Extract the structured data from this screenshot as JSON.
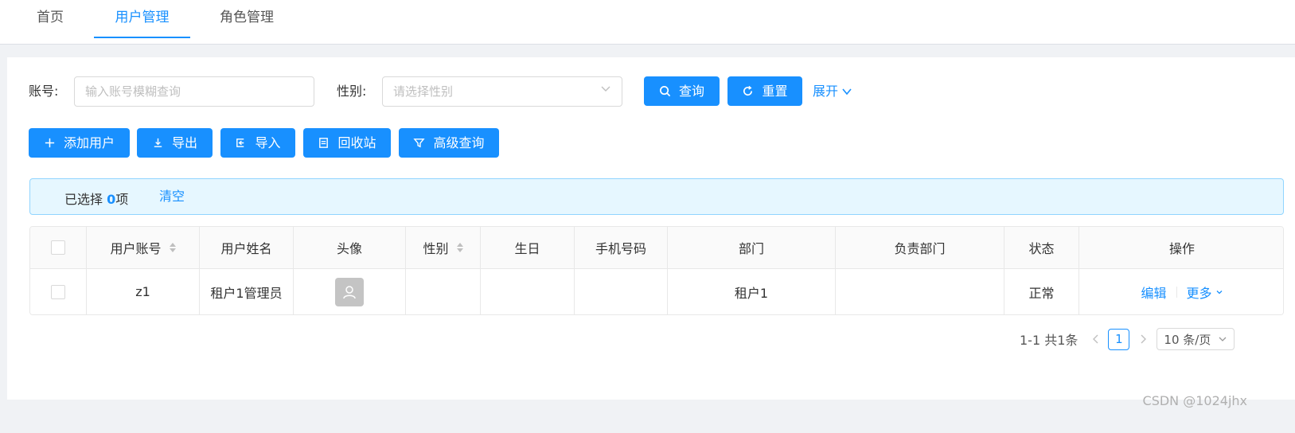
{
  "tabs": [
    {
      "label": "首页",
      "active": false
    },
    {
      "label": "用户管理",
      "active": true
    },
    {
      "label": "角色管理",
      "active": false
    }
  ],
  "search": {
    "account_label": "账号:",
    "account_placeholder": "输入账号模糊查询",
    "gender_label": "性别:",
    "gender_placeholder": "请选择性别",
    "query_button": "查询",
    "reset_button": "重置",
    "expand_link": "展开"
  },
  "toolbar": {
    "add_user": "添加用户",
    "export": "导出",
    "import": "导入",
    "recycle": "回收站",
    "advanced_query": "高级查询"
  },
  "selection": {
    "prefix": "已选择",
    "count": "0",
    "suffix": "项",
    "clear": "清空"
  },
  "table": {
    "columns": [
      "用户账号",
      "用户姓名",
      "头像",
      "性别",
      "生日",
      "手机号码",
      "部门",
      "负责部门",
      "状态",
      "操作"
    ],
    "rows": [
      {
        "account": "z1",
        "name": "租户1管理员",
        "gender": "",
        "birthday": "",
        "phone": "",
        "department": "租户1",
        "responsible_department": "",
        "status": "正常",
        "edit": "编辑",
        "more": "更多"
      }
    ]
  },
  "pagination": {
    "summary": "1-1 共1条",
    "current_page": "1",
    "page_size": "10 条/页"
  },
  "watermark": "CSDN @1024jhx",
  "colors": {
    "primary": "#1890ff",
    "alert_bg": "#e6f7ff",
    "alert_border": "#91d5ff"
  }
}
